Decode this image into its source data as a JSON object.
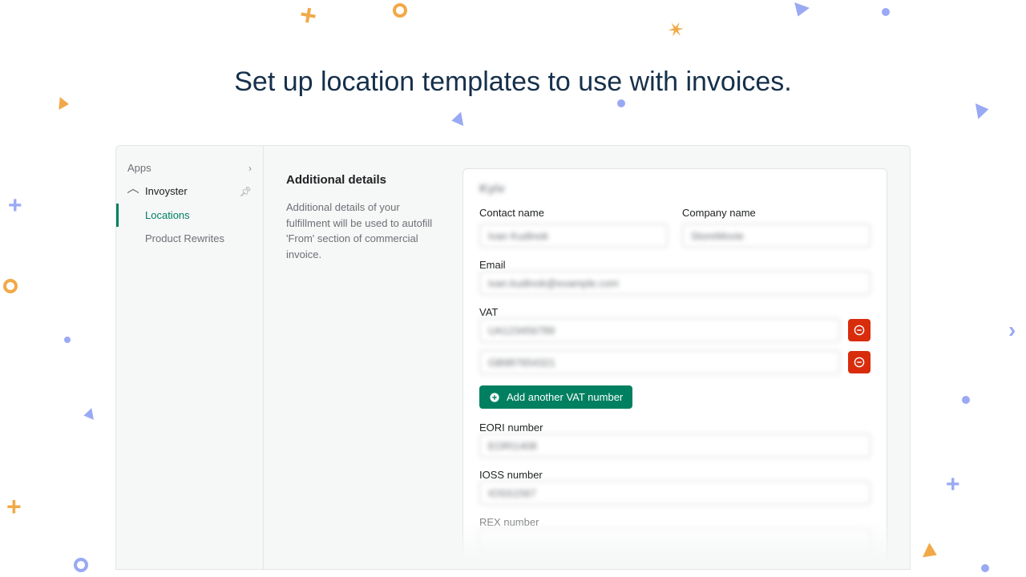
{
  "title": "Set up location templates to use with invoices.",
  "sidebar": {
    "header": "Apps",
    "app_name": "Invoyster",
    "items": [
      {
        "label": "Locations",
        "active": true
      },
      {
        "label": "Product Rewrites",
        "active": false
      }
    ]
  },
  "intro": {
    "heading": "Additional details",
    "description": "Additional details of your fulfillment will be used to autofill 'From' section of commercial invoice."
  },
  "panel": {
    "heading_blur": "Kyiv",
    "labels": {
      "contact": "Contact name",
      "company": "Company name",
      "email": "Email",
      "vat": "VAT",
      "eori": "EORI number",
      "ioss": "IOSS number",
      "rex": "REX number"
    },
    "values": {
      "contact": "Ivan Kudinok",
      "company": "StoreMovie",
      "email": "ivan.kudinok@example.com",
      "vat1": "UA123456789",
      "vat2": "GB987654321",
      "eori": "EORI1408",
      "ioss": "IOSS1567",
      "rex": ""
    },
    "add_vat_label": "Add another VAT number"
  },
  "colors": {
    "brand": "#008060",
    "danger": "#d82c0d",
    "heading": "#16304b",
    "accent_blue": "#9aa9f4",
    "accent_orange": "#f1a948"
  }
}
